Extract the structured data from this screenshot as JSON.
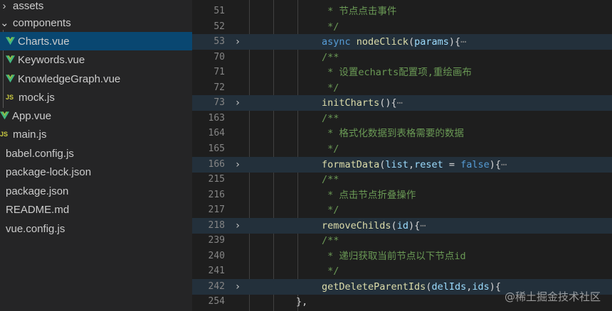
{
  "explorer": {
    "items": [
      {
        "label": "assets",
        "kind": "folder",
        "chevron": "›"
      },
      {
        "label": "components",
        "kind": "folder",
        "chevron": "⌄"
      },
      {
        "label": "Charts.vue",
        "kind": "vue",
        "selected": true
      },
      {
        "label": "Keywords.vue",
        "kind": "vue"
      },
      {
        "label": "KnowledgeGraph.vue",
        "kind": "vue"
      },
      {
        "label": "mock.js",
        "kind": "js"
      },
      {
        "label": "App.vue",
        "kind": "vue"
      },
      {
        "label": "main.js",
        "kind": "js"
      },
      {
        "label": "babel.config.js",
        "kind": "plain"
      },
      {
        "label": "package-lock.json",
        "kind": "plain"
      },
      {
        "label": "package.json",
        "kind": "plain"
      },
      {
        "label": "README.md",
        "kind": "plain"
      },
      {
        "label": "vue.config.js",
        "kind": "plain"
      }
    ],
    "js_badge": "JS"
  },
  "editor": {
    "lines": [
      {
        "num": "51",
        "tokens": [
          [
            "c-comment",
            " * 节点点击事件"
          ]
        ]
      },
      {
        "num": "52",
        "tokens": [
          [
            "c-comment",
            " */"
          ]
        ]
      },
      {
        "num": "53",
        "folded": true,
        "tokens": [
          [
            "c-kw",
            "async "
          ],
          [
            "c-fn",
            "nodeClick"
          ],
          [
            "c-punc",
            "("
          ],
          [
            "c-param",
            "params"
          ],
          [
            "c-punc",
            "){"
          ],
          [
            "c-fold",
            "⋯"
          ]
        ]
      },
      {
        "num": "70",
        "tokens": [
          [
            "c-comment",
            "/**"
          ]
        ]
      },
      {
        "num": "71",
        "tokens": [
          [
            "c-comment",
            " * 设置echarts配置项,重绘画布"
          ]
        ]
      },
      {
        "num": "72",
        "tokens": [
          [
            "c-comment",
            " */"
          ]
        ]
      },
      {
        "num": "73",
        "folded": true,
        "tokens": [
          [
            "c-fn",
            "initCharts"
          ],
          [
            "c-punc",
            "(){"
          ],
          [
            "c-fold",
            "⋯"
          ]
        ]
      },
      {
        "num": "163",
        "tokens": [
          [
            "c-comment",
            "/**"
          ]
        ]
      },
      {
        "num": "164",
        "tokens": [
          [
            "c-comment",
            " * 格式化数据到表格需要的数据"
          ]
        ]
      },
      {
        "num": "165",
        "tokens": [
          [
            "c-comment",
            " */"
          ]
        ]
      },
      {
        "num": "166",
        "folded": true,
        "tokens": [
          [
            "c-fn",
            "formatData"
          ],
          [
            "c-punc",
            "("
          ],
          [
            "c-param",
            "list"
          ],
          [
            "c-punc",
            ","
          ],
          [
            "c-param",
            "reset"
          ],
          [
            "c-op",
            " = "
          ],
          [
            "c-kw",
            "false"
          ],
          [
            "c-punc",
            "){"
          ],
          [
            "c-fold",
            "⋯"
          ]
        ]
      },
      {
        "num": "215",
        "tokens": [
          [
            "c-comment",
            "/**"
          ]
        ]
      },
      {
        "num": "216",
        "tokens": [
          [
            "c-comment",
            " * 点击节点折叠操作"
          ]
        ]
      },
      {
        "num": "217",
        "tokens": [
          [
            "c-comment",
            " */"
          ]
        ]
      },
      {
        "num": "218",
        "folded": true,
        "tokens": [
          [
            "c-fn",
            "removeChilds"
          ],
          [
            "c-punc",
            "("
          ],
          [
            "c-param",
            "id"
          ],
          [
            "c-punc",
            "){"
          ],
          [
            "c-fold",
            "⋯"
          ]
        ]
      },
      {
        "num": "239",
        "tokens": [
          [
            "c-comment",
            "/**"
          ]
        ]
      },
      {
        "num": "240",
        "tokens": [
          [
            "c-comment",
            " * 递归获取当前节点以下节点id"
          ]
        ]
      },
      {
        "num": "241",
        "tokens": [
          [
            "c-comment",
            " */"
          ]
        ]
      },
      {
        "num": "242",
        "folded": true,
        "tokens": [
          [
            "c-fn",
            "getDeleteParentIds"
          ],
          [
            "c-punc",
            "("
          ],
          [
            "c-param",
            "delIds"
          ],
          [
            "c-punc",
            ","
          ],
          [
            "c-param",
            "ids"
          ],
          [
            "c-punc",
            "){"
          ]
        ]
      },
      {
        "num": "254",
        "close": true,
        "tokens": [
          [
            "c-punc",
            "},"
          ]
        ]
      }
    ],
    "fold_glyph": "›"
  },
  "watermark": "@稀土掘金技术社区",
  "colors": {
    "vue_green": "#41b883",
    "vue_dark": "#8dc149",
    "selection": "#094771",
    "js_badge": "#cbcb41"
  }
}
